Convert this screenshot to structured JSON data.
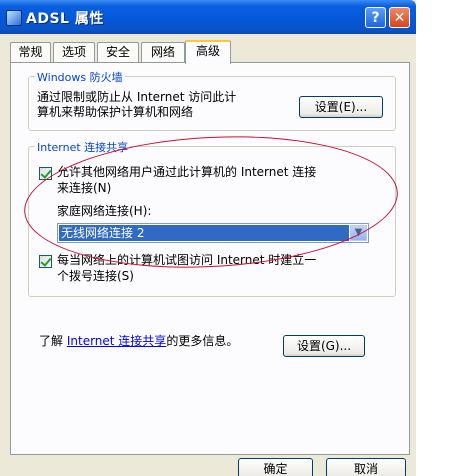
{
  "window": {
    "title": "ADSL 属性",
    "help_label": "?",
    "close_label": "✕"
  },
  "tabs": [
    {
      "label": "常规"
    },
    {
      "label": "选项"
    },
    {
      "label": "安全"
    },
    {
      "label": "网络"
    },
    {
      "label": "高级",
      "active": true
    }
  ],
  "firewall": {
    "group_title": "Windows 防火墙",
    "description_line1": "通过限制或防止从 Internet 访问此计",
    "description_line2": "算机来帮助保护计算机和网络",
    "settings_button": "设置(E)..."
  },
  "ics": {
    "group_title": "Internet 连接共享",
    "allow_checked": true,
    "allow_label_line1": "允许其他网络用户通过此计算机的 Internet 连接",
    "allow_label_line2": "来连接(N)",
    "home_network_label": "家庭网络连接(H):",
    "home_network_value": "无线网络连接 2",
    "dial_checked": true,
    "dial_label_line1": "每当网络上的计算机试图访问 Internet 时建立一",
    "dial_label_line2": "个拨号连接(S)"
  },
  "footer": {
    "learn_prefix": "了解",
    "learn_link": "Internet 连接共享",
    "learn_suffix": "的更多信息。",
    "settings_button": "设置(G)..."
  },
  "buttons": {
    "ok": "确定",
    "cancel": "取消"
  },
  "annotation_color": "#c8102e"
}
